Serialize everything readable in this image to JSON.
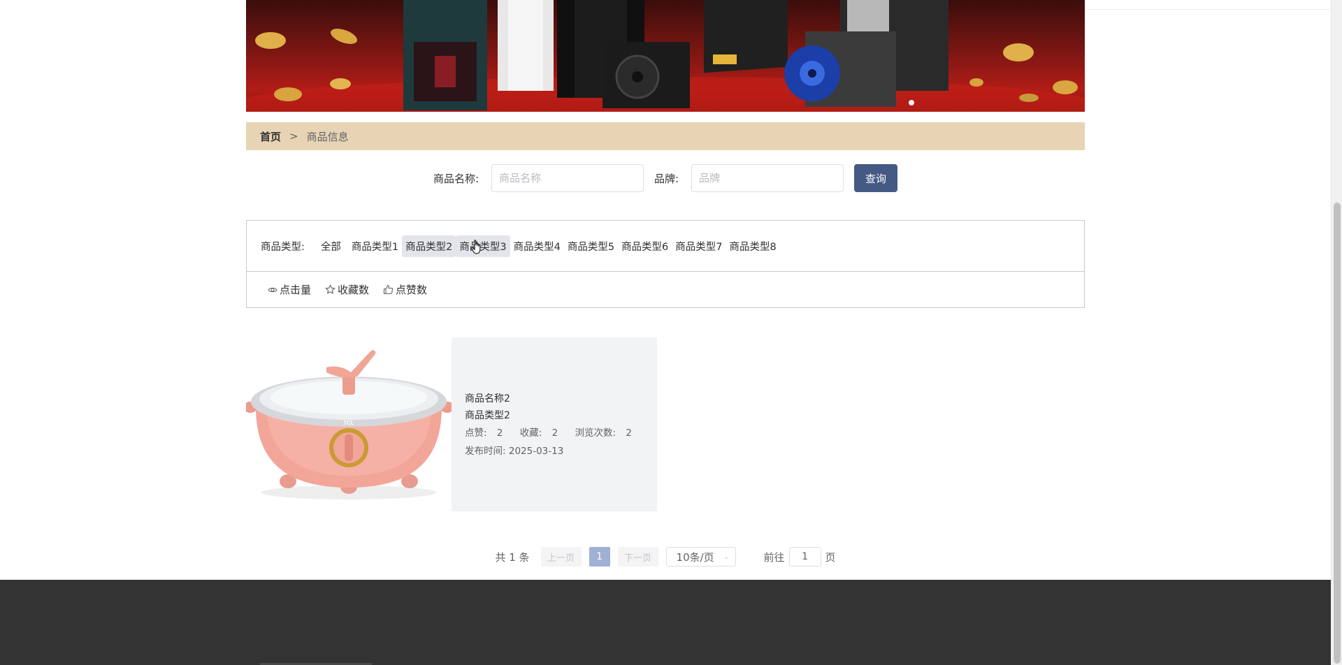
{
  "breadcrumb": {
    "home": "首页",
    "separator": ">",
    "current": "商品信息"
  },
  "search": {
    "name_label": "商品名称:",
    "name_placeholder": "商品名称",
    "brand_label": "品牌:",
    "brand_placeholder": "品牌",
    "query_button": "查询"
  },
  "filter": {
    "type_label": "商品类型:",
    "types": [
      "全部",
      "商品类型1",
      "商品类型2",
      "商品类型3",
      "商品类型4",
      "商品类型5",
      "商品类型6",
      "商品类型7",
      "商品类型8"
    ],
    "active_type": "商品类型2"
  },
  "sort": {
    "clicks": "点击量",
    "favorites": "收藏数",
    "likes": "点赞数"
  },
  "product": {
    "name": "商品名称2",
    "type": "商品类型2",
    "likes_label": "点赞:",
    "likes": "2",
    "favorites_label": "收藏:",
    "favorites": "2",
    "views_label": "浏览次数:",
    "views": "2",
    "date_label": "发布时间:",
    "date": "2025-03-13",
    "image_brand": "TCL"
  },
  "pagination": {
    "total": "共 1 条",
    "prev": "上一页",
    "current_page": "1",
    "next": "下一页",
    "page_size": "10条/页",
    "goto_label": "前往",
    "goto_value": "1",
    "page_suffix": "页"
  },
  "colors": {
    "breadcrumb_bg": "#e8d4b4",
    "primary_button": "#445a85",
    "footer": "#333333",
    "active_page": "#a0b0d4"
  },
  "icons": {
    "clicks": "eye-icon",
    "favorites": "star-icon",
    "likes": "thumbs-up-icon",
    "select": "chevron-down-icon"
  }
}
